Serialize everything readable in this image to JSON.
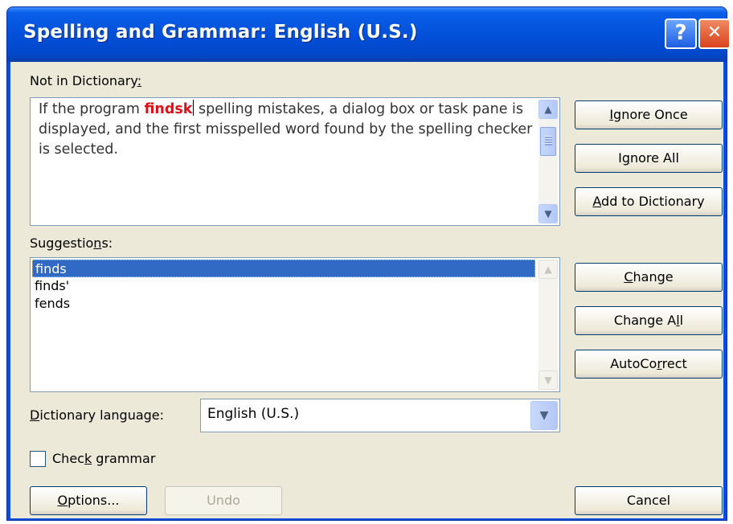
{
  "window": {
    "title": "Spelling and Grammar: English (U.S.)",
    "help_glyph": "?",
    "close_glyph": "✕"
  },
  "not_in_dictionary": {
    "label_pre": "Not in Dictionary",
    "label_access": ":",
    "text_before": "If the program ",
    "misspelled_word": "findsk",
    "text_after": " spelling mistakes, a dialog box or task pane is displayed, and the first misspelled word found by the spelling checker is selected."
  },
  "suggestions": {
    "label_pre": "Suggestio",
    "label_access": "n",
    "label_post": "s:",
    "items": [
      "finds",
      "finds'",
      "fends"
    ],
    "selected_index": 0
  },
  "dictionary_language": {
    "label_access": "D",
    "label_post": "ictionary language:",
    "value": "English (U.S.)"
  },
  "check_grammar": {
    "label_pre": "Chec",
    "label_access": "k",
    "label_post": " grammar",
    "checked": false
  },
  "buttons": {
    "ignore_once": {
      "pre": "",
      "access": "I",
      "post": "gnore Once"
    },
    "ignore_all": {
      "pre": "I",
      "access": "g",
      "post": "nore All"
    },
    "add_to_dictionary": {
      "pre": "",
      "access": "A",
      "post": "dd to Dictionary"
    },
    "change": {
      "pre": "",
      "access": "C",
      "post": "hange"
    },
    "change_all": {
      "pre": "Change A",
      "access": "l",
      "post": "l"
    },
    "autocorrect": {
      "pre": "AutoCo",
      "access": "r",
      "post": "rect"
    },
    "options": {
      "pre": "",
      "access": "O",
      "post": "ptions..."
    },
    "undo": {
      "label": "Undo"
    },
    "cancel": {
      "label": "Cancel"
    }
  },
  "icons": {
    "scroll_up": "▲",
    "scroll_down": "▼",
    "dropdown": "▼"
  },
  "colors": {
    "title_bar": "#0350da",
    "misspelled": "#e0101a",
    "selection": "#316ac5",
    "dialog_face": "#ece9d8"
  }
}
